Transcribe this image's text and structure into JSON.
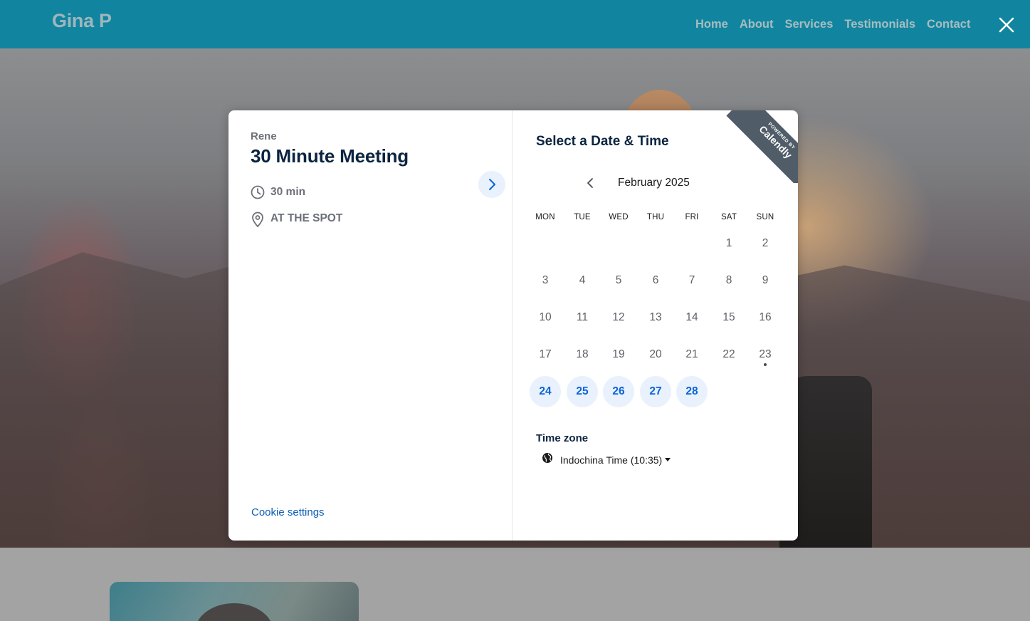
{
  "site": {
    "brand": "Gina P",
    "nav": [
      "Home",
      "About",
      "Services",
      "Testimonials",
      "Contact"
    ],
    "close_icon": "close-icon"
  },
  "scheduler": {
    "host": "Rene",
    "event_title": "30 Minute Meeting",
    "duration": "30 min",
    "location": "AT THE SPOT",
    "cookie_settings": "Cookie settings",
    "picker_title": "Select a Date & Time",
    "ribbon_small": "POWERED BY",
    "ribbon_brand": "Calendly",
    "month": "February 2025",
    "weekdays": [
      "MON",
      "TUE",
      "WED",
      "THU",
      "FRI",
      "SAT",
      "SUN"
    ],
    "days": [
      "1",
      "2",
      "3",
      "4",
      "5",
      "6",
      "7",
      "8",
      "9",
      "10",
      "11",
      "12",
      "13",
      "14",
      "15",
      "16",
      "17",
      "18",
      "19",
      "20",
      "21",
      "22",
      "23",
      "24",
      "25",
      "26",
      "27",
      "28"
    ],
    "available_days": [
      "24",
      "25",
      "26",
      "27",
      "28"
    ],
    "today": "23",
    "timezone_heading": "Time zone",
    "timezone_value": "Indochina Time (10:35)"
  },
  "colors": {
    "header": "#11859f",
    "accent": "#0a63d8",
    "available_bg": "#e8f1fc",
    "title": "#0b2440"
  }
}
